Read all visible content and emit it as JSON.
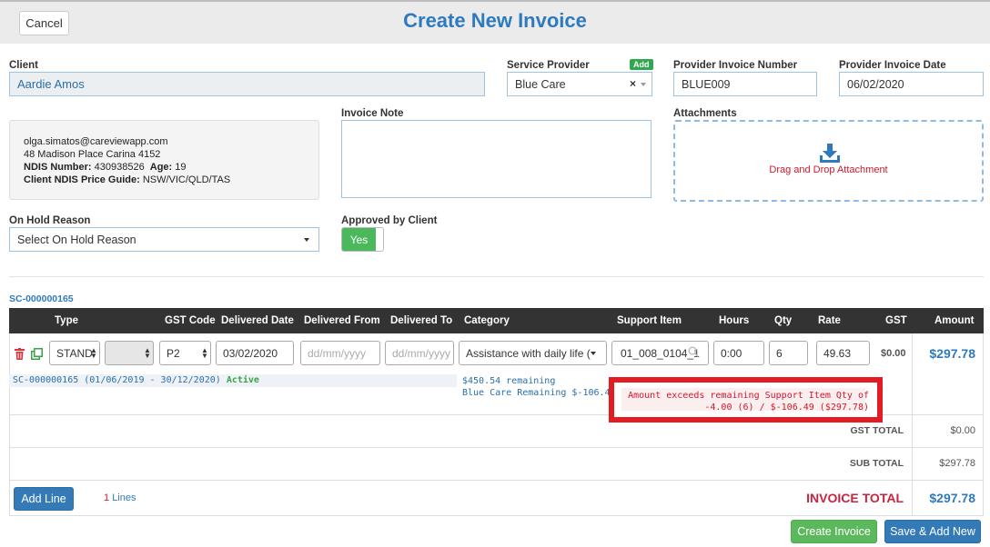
{
  "header": {
    "cancel_label": "Cancel",
    "title": "Create New Invoice"
  },
  "client": {
    "label": "Client",
    "value": "Aardie Amos",
    "email": "olga.simatos@careviewapp.com",
    "address": "48 Madison Place Carina 4152",
    "ndis_label": "NDIS Number:",
    "ndis_value": "430938526",
    "age_label": "Age:",
    "age_value": "19",
    "price_guide_label": "Client NDIS Price Guide:",
    "price_guide_value": "NSW/VIC/QLD/TAS"
  },
  "provider": {
    "label": "Service Provider",
    "add_label": "Add",
    "value": "Blue Care",
    "clear_glyph": "×"
  },
  "invoice_number": {
    "label": "Provider Invoice Number",
    "value": "BLUE009"
  },
  "invoice_date": {
    "label": "Provider Invoice Date",
    "value": "06/02/2020"
  },
  "note": {
    "label": "Invoice Note",
    "value": ""
  },
  "attachments": {
    "label": "Attachments",
    "drop_text": "Drag and Drop Attachment",
    "icon": "download-tray-icon"
  },
  "on_hold": {
    "label": "On Hold Reason",
    "value": "Select On Hold Reason"
  },
  "approved": {
    "label": "Approved by Client",
    "value": "Yes"
  },
  "service_contract": {
    "id": "SC-000000165"
  },
  "table": {
    "headers": [
      "Type",
      "GST Code",
      "Delivered Date",
      "Delivered From",
      "Delivered To",
      "Category",
      "Support Item",
      "Hours",
      "Qty",
      "Rate",
      "GST",
      "Amount"
    ],
    "row": {
      "type": "STAND",
      "blank_select": "",
      "gst_code": "P2",
      "delivered_date": "03/02/2020",
      "from_placeholder": "dd/mm/yyyy",
      "to_placeholder": "dd/mm/yyyy",
      "category": "Assistance with daily life (",
      "support_item": "01_008_0104_1",
      "hours": "0:00",
      "qty": "6",
      "rate": "49.63",
      "gst": "$0.00",
      "amount": "$297.78"
    },
    "contract_line": "SC-000000165 (01/06/2019 - 30/12/2020)",
    "contract_status": "Active",
    "remaining_line1": "$450.54 remaining",
    "remaining_line2": "Blue Care Remaining $-106.49",
    "error_line1": "Amount exceeds remaining Support Item Qty of",
    "error_line2": "-4.00 (6) / $-106.49 ($297.78)"
  },
  "totals": {
    "gst_label": "GST TOTAL",
    "gst_value": "$0.00",
    "sub_label": "SUB TOTAL",
    "sub_value": "$297.78",
    "invoice_label": "INVOICE TOTAL",
    "invoice_value": "$297.78"
  },
  "footer": {
    "add_line_label": "Add Line",
    "lines_count": "1",
    "lines_label": "Lines",
    "create_label": "Create Invoice",
    "save_add_label": "Save & Add New"
  },
  "colors": {
    "accent": "#2f7abf",
    "success": "#5cb85c",
    "error": "#e31b23",
    "total_red": "#c9243f"
  }
}
